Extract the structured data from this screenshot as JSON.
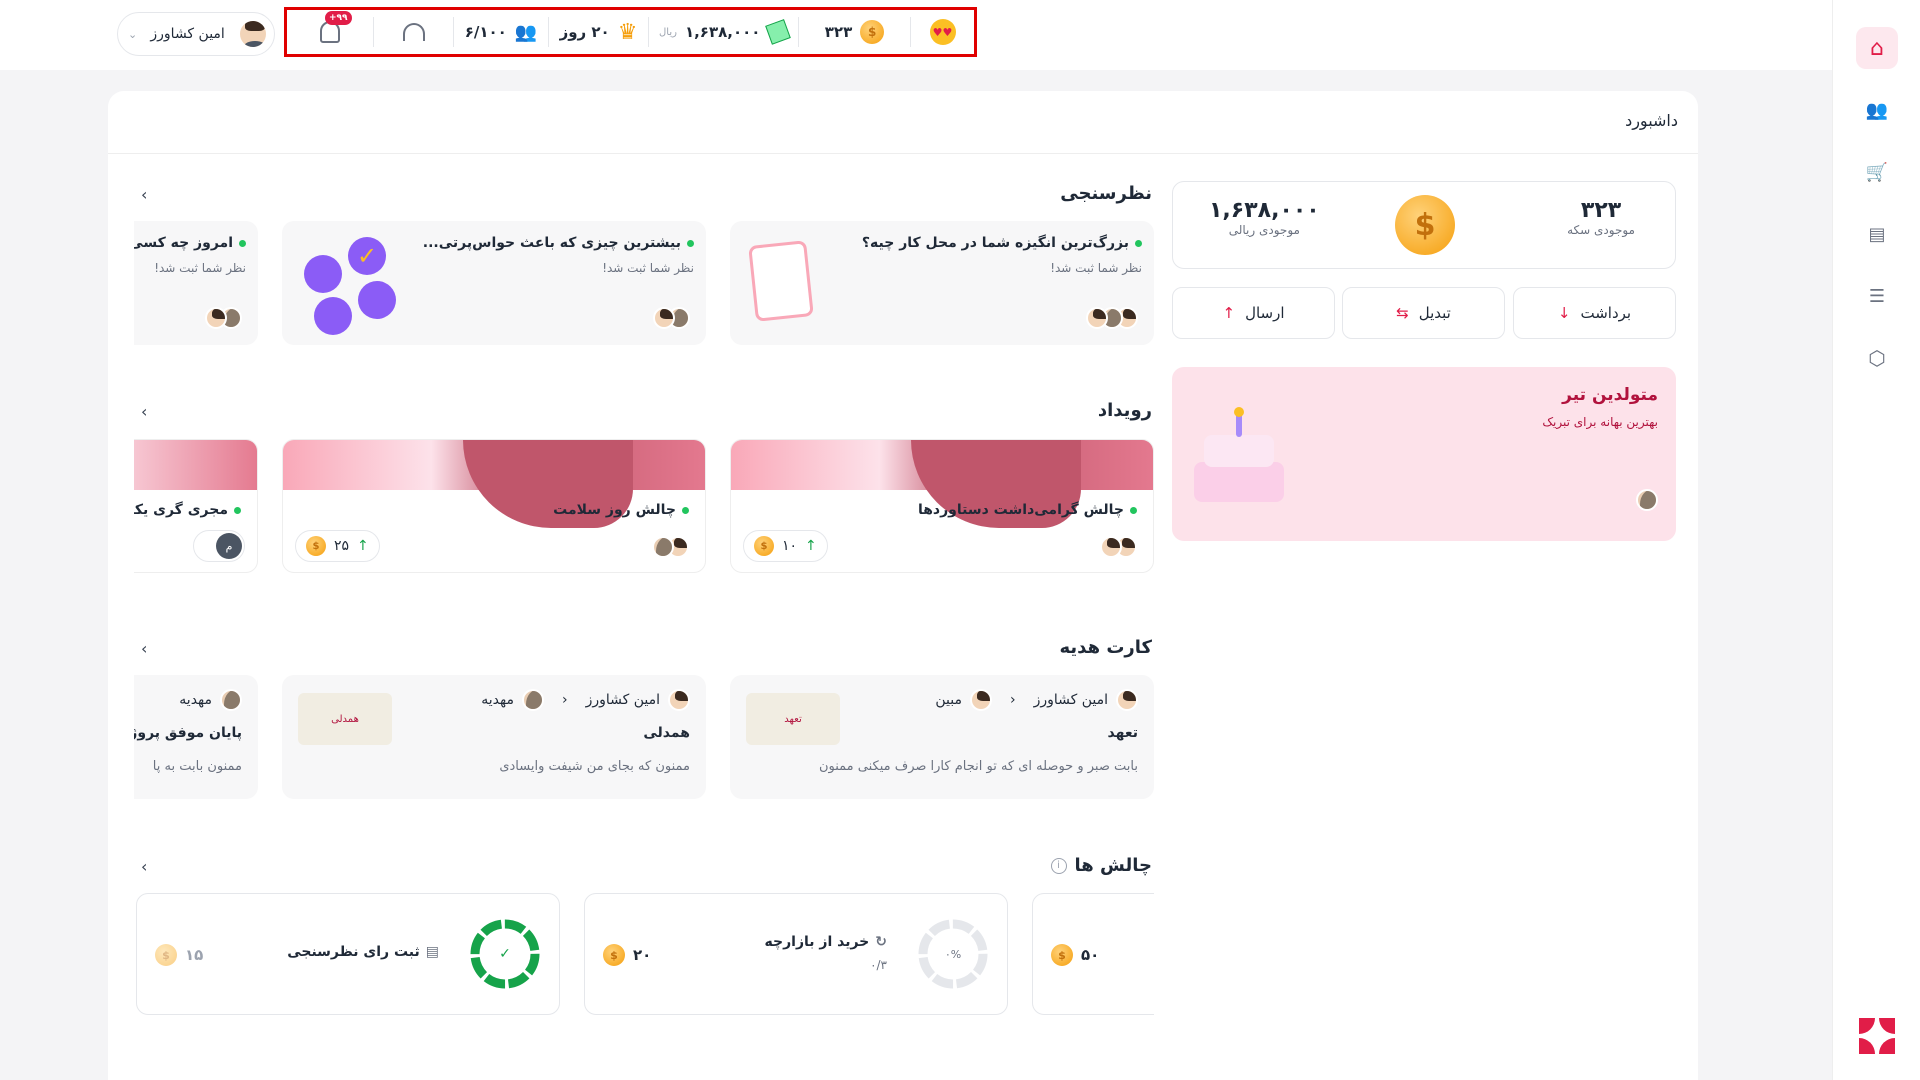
{
  "header": {
    "user_name": "امین کشاورز",
    "notifications_badge": "+۹۹",
    "level": "۶/۱۰۰",
    "streak": "۲۰ روز",
    "rial_amount": "۱,۶۳۸,۰۰۰",
    "rial_unit": "ریال",
    "coins": "۳۲۳"
  },
  "sidebar": {
    "items": [
      "home-icon",
      "users-icon",
      "cart-icon",
      "chart-icon",
      "sliders-icon",
      "settings-icon"
    ]
  },
  "page": {
    "title": "داشبورد"
  },
  "wallet": {
    "coins_value": "۳۲۳",
    "coins_label": "موجودی سکه",
    "rial_value": "۱,۶۳۸,۰۰۰",
    "rial_label": "موجودی ریالی",
    "withdraw": "برداشت",
    "convert": "تبدیل",
    "send": "ارسال"
  },
  "birthday": {
    "title": "متولدین تیر",
    "subtitle": "بهترین بهانه برای تبریک"
  },
  "surveys": {
    "heading": "نظرسنجی",
    "items": [
      {
        "title": "بزرگ‌ترین انگیزه شما در محل کار چیه؟",
        "status": "نظر شما ثبت شد!"
      },
      {
        "title": "بیشترین چیزی که باعث حواس‌پرتی...",
        "status": "نظر شما ثبت شد!"
      },
      {
        "title": "امروز چه کسی",
        "status": "نظر شما ثبت شد!"
      }
    ]
  },
  "events": {
    "heading": "رویداد",
    "items": [
      {
        "title": "چالش گرامی‌داشت دستاوردها",
        "coins": "۱۰"
      },
      {
        "title": "چالش روز سلامت",
        "coins": "۲۵"
      },
      {
        "title": "مجری گری یکر",
        "badge": "م"
      }
    ]
  },
  "gift_cards": {
    "heading": "کارت هدیه",
    "items": [
      {
        "from": "امین کشاورز",
        "to": "مبین",
        "title": "تعهد",
        "message": "بابت صبر و حوصله ای که تو انجام کارا صرف میکنی ممنون",
        "card_text": "تعهد"
      },
      {
        "from": "امین کشاورز",
        "to": "مهدیه",
        "title": "همدلی",
        "message": "ممنون که بجای من شیفت وایسادی",
        "card_text": "همدلی"
      },
      {
        "from": "مهدیه",
        "title": "پایان موفق پروژه",
        "message": "ممنون بابت به پا"
      }
    ]
  },
  "challenges": {
    "heading": "چالش ها",
    "items": [
      {
        "coins": "۵۰"
      },
      {
        "title": "خرید از بازارچه",
        "progress_text": "۰%",
        "count": "۰/۳",
        "coins": "۲۰",
        "progress": 0
      },
      {
        "title": "ثبت رای نظرسنجی",
        "coins": "۱۵",
        "progress": 1.0,
        "check": "✓"
      }
    ]
  },
  "colors": {
    "accent": "#e11d48",
    "green": "#16a34a",
    "pink_bg": "#fde8ee",
    "coin": "#f59e0b"
  }
}
